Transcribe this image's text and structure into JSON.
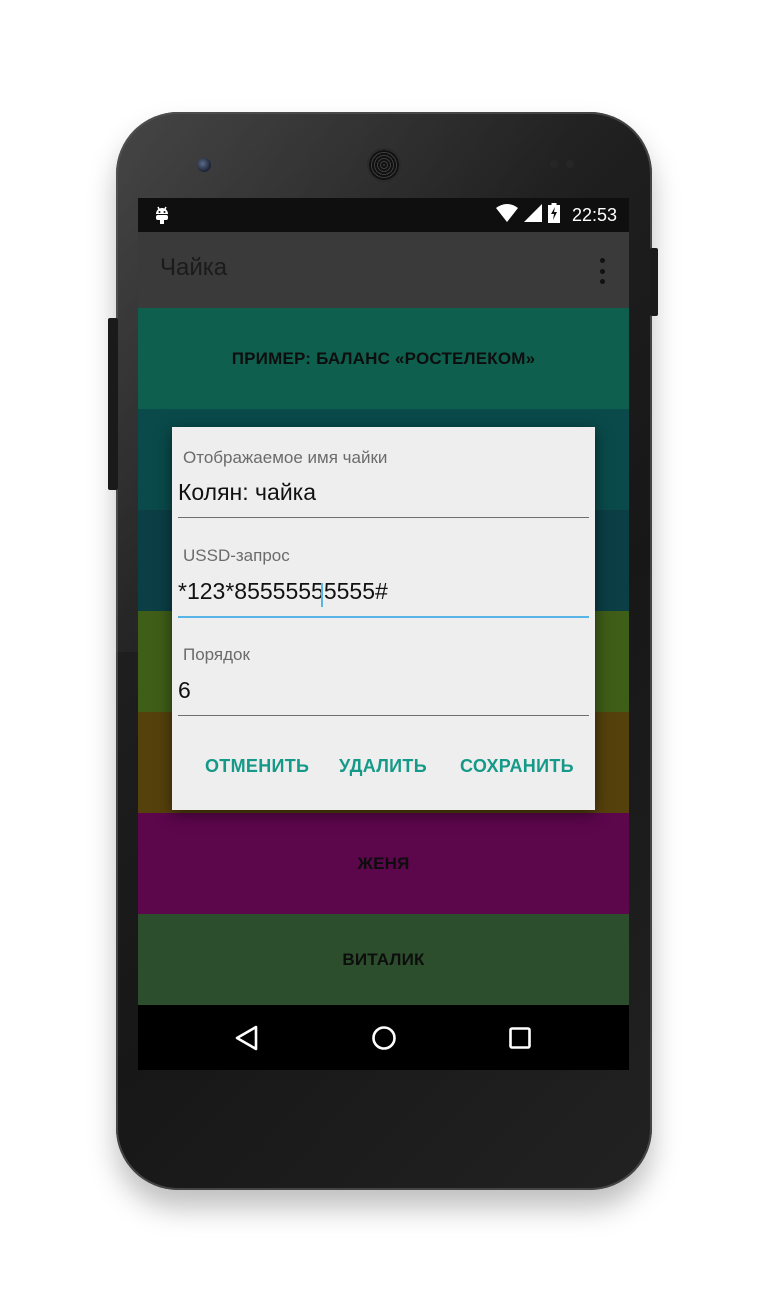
{
  "status_bar": {
    "time": "22:53",
    "icons": [
      "android-debug-icon",
      "wifi-icon",
      "signal-icon",
      "battery-charging-icon"
    ]
  },
  "app_bar": {
    "title": "Чайка",
    "menu_icon": "overflow-menu-icon"
  },
  "list": {
    "items": [
      {
        "label": "ПРИМЕР: БАЛАНС «РОСТЕЛЕКОМ»",
        "color": "#0f5f4f"
      },
      {
        "label": "",
        "color": "#0a4a4a"
      },
      {
        "label": "",
        "color": "#0b3e45"
      },
      {
        "label": "",
        "color": "#3f5e17"
      },
      {
        "label": "",
        "color": "#55410c"
      },
      {
        "label": "ЖЕНЯ",
        "color": "#5c064c"
      },
      {
        "label": "ВИТАЛИК",
        "color": "#2c4e2c"
      }
    ]
  },
  "dialog": {
    "name_label": "Отображаемое имя чайки",
    "name_value": "Колян: чайка",
    "ussd_label": "USSD-запрос",
    "ussd_value": "*123*85555555555#",
    "order_label": "Порядок",
    "order_value": "6",
    "cancel_label": "ОТМЕНИТЬ",
    "delete_label": "УДАЛИТЬ",
    "save_label": "СОХРАНИТЬ",
    "accent_color": "#159988",
    "focus_color": "#58b4e6"
  },
  "nav_bar": {
    "icons": [
      "back-icon",
      "home-icon",
      "recents-icon"
    ]
  }
}
